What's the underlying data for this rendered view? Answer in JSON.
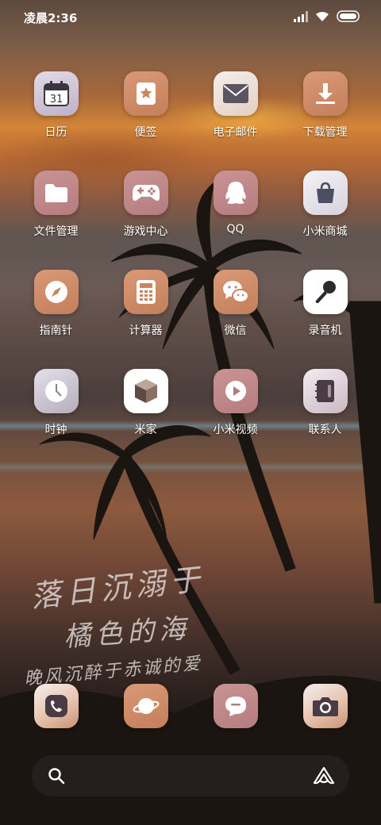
{
  "status_bar": {
    "time": "凌晨2:36",
    "signal_icon": "signal-icon",
    "wifi_icon": "wifi-icon",
    "battery_icon": "battery-icon"
  },
  "apps": [
    {
      "label": "日历",
      "icon": "calendar-icon",
      "icon_text": "31"
    },
    {
      "label": "便签",
      "icon": "notes-icon"
    },
    {
      "label": "电子邮件",
      "icon": "mail-icon"
    },
    {
      "label": "下载管理",
      "icon": "download-icon"
    },
    {
      "label": "文件管理",
      "icon": "folder-icon"
    },
    {
      "label": "游戏中心",
      "icon": "gamepad-icon"
    },
    {
      "label": "QQ",
      "icon": "qq-penguin-icon"
    },
    {
      "label": "小米商城",
      "icon": "shopping-bag-icon"
    },
    {
      "label": "指南针",
      "icon": "compass-icon"
    },
    {
      "label": "计算器",
      "icon": "calculator-icon"
    },
    {
      "label": "微信",
      "icon": "wechat-icon"
    },
    {
      "label": "录音机",
      "icon": "microphone-icon"
    },
    {
      "label": "时钟",
      "icon": "clock-icon"
    },
    {
      "label": "米家",
      "icon": "cube-icon"
    },
    {
      "label": "小米视频",
      "icon": "play-icon"
    },
    {
      "label": "联系人",
      "icon": "contacts-book-icon"
    }
  ],
  "dock": [
    {
      "icon": "phone-icon"
    },
    {
      "icon": "browser-planet-icon"
    },
    {
      "icon": "message-icon"
    },
    {
      "icon": "camera-icon"
    }
  ],
  "wallpaper_text": {
    "line1": "落日沉溺于",
    "line2": "橘色的海",
    "line3": "晚风沉醉于赤诚的爱"
  },
  "search_bar": {
    "search_icon": "search-icon",
    "assistant_icon": "xiaoai-icon"
  }
}
